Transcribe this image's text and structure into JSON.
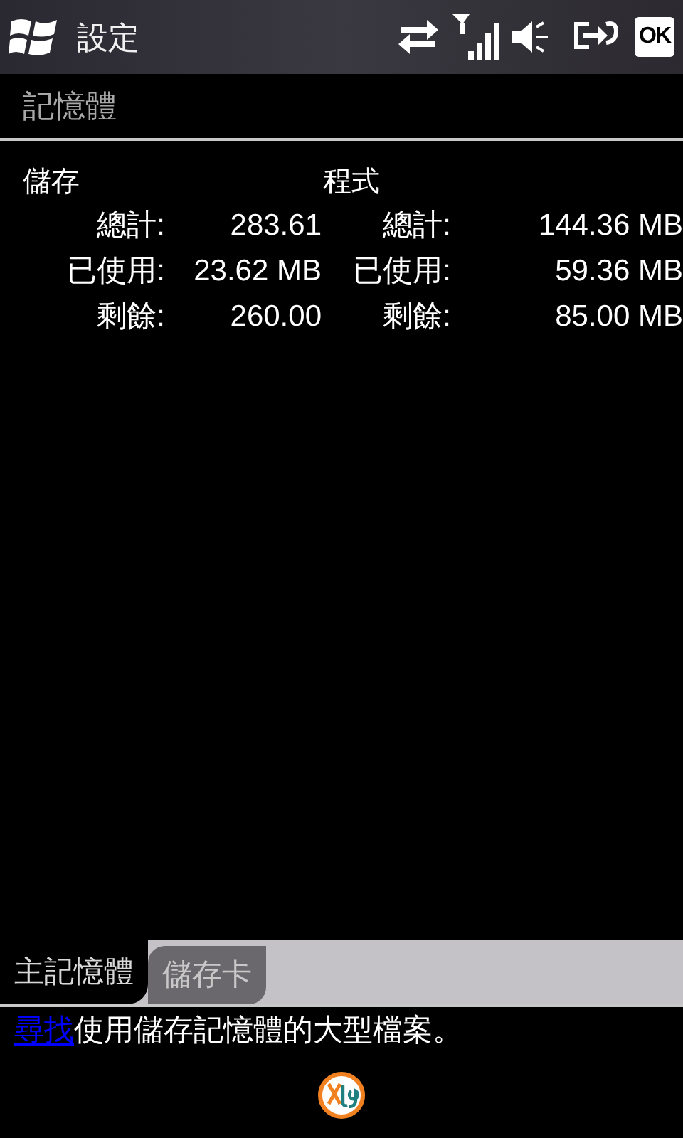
{
  "title_bar": {
    "title": "設定",
    "ok": "OK"
  },
  "page_title": "記憶體",
  "sections": [
    {
      "heading": "儲存",
      "rows": [
        {
          "label": "總計:",
          "value": "283.61"
        },
        {
          "label": "已使用:",
          "value": "23.62 MB"
        },
        {
          "label": "剩餘:",
          "value": "260.00"
        }
      ]
    },
    {
      "heading": "程式",
      "rows": [
        {
          "label": "總計:",
          "value": "144.36 MB"
        },
        {
          "label": "已使用:",
          "value": "59.36 MB"
        },
        {
          "label": "剩餘:",
          "value": "85.00 MB"
        }
      ]
    }
  ],
  "tabs": [
    {
      "label": "主記憶體",
      "selected": true
    },
    {
      "label": "儲存卡",
      "selected": false
    }
  ],
  "hint": {
    "link": "尋找",
    "text": "使用儲存記憶體的大型檔案。"
  }
}
